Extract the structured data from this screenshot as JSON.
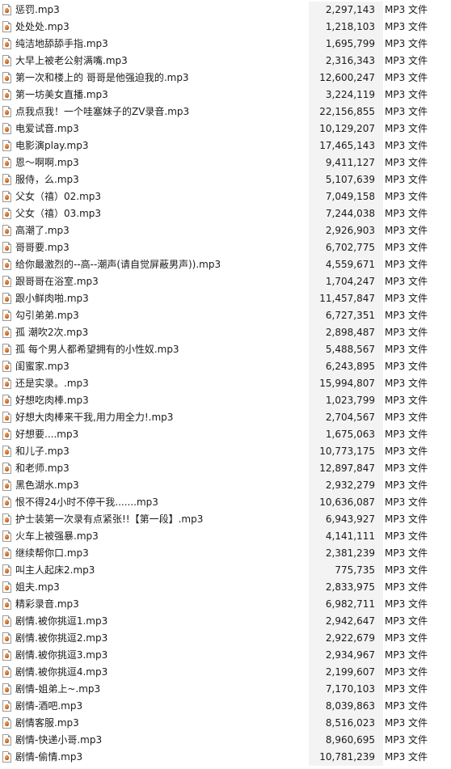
{
  "file_icon_name": "mp3-file-icon",
  "colors": {
    "background": "#ffffff",
    "size_column_band": "#f3f3f3",
    "text": "#1a1a1a"
  },
  "files": [
    {
      "name": "惩罚.mp3",
      "size": "2,297,143",
      "type": "MP3 文件"
    },
    {
      "name": "处处处.mp3",
      "size": "1,218,103",
      "type": "MP3 文件"
    },
    {
      "name": "纯洁地舔舔手指.mp3",
      "size": "1,695,799",
      "type": "MP3 文件"
    },
    {
      "name": "大早上被老公射满嘴.mp3",
      "size": "2,316,343",
      "type": "MP3 文件"
    },
    {
      "name": "第一次和楼上的 哥哥是他强迫我的.mp3",
      "size": "12,600,247",
      "type": "MP3 文件"
    },
    {
      "name": "第一坊美女直播.mp3",
      "size": "3,224,119",
      "type": "MP3 文件"
    },
    {
      "name": "点我点我！一个哇塞妹子的ZV录音.mp3",
      "size": "22,156,855",
      "type": "MP3 文件"
    },
    {
      "name": "电爱试音.mp3",
      "size": "10,129,207",
      "type": "MP3 文件"
    },
    {
      "name": "电影演play.mp3",
      "size": "17,465,143",
      "type": "MP3 文件"
    },
    {
      "name": "恩～啊啊.mp3",
      "size": "9,411,127",
      "type": "MP3 文件"
    },
    {
      "name": "服侍，么.mp3",
      "size": "5,107,639",
      "type": "MP3 文件"
    },
    {
      "name": "父女（禧）02.mp3",
      "size": "7,049,158",
      "type": "MP3 文件"
    },
    {
      "name": "父女（禧）03.mp3",
      "size": "7,244,038",
      "type": "MP3 文件"
    },
    {
      "name": "高潮了.mp3",
      "size": "2,926,903",
      "type": "MP3 文件"
    },
    {
      "name": "哥哥要.mp3",
      "size": "6,702,775",
      "type": "MP3 文件"
    },
    {
      "name": "给你最激烈的--高--潮声(请自觉屏蔽男声)).mp3",
      "size": "4,559,671",
      "type": "MP3 文件"
    },
    {
      "name": "跟哥哥在浴室.mp3",
      "size": "1,704,247",
      "type": "MP3 文件"
    },
    {
      "name": "跟小鲜肉啪.mp3",
      "size": "11,457,847",
      "type": "MP3 文件"
    },
    {
      "name": "勾引弟弟.mp3",
      "size": "6,727,351",
      "type": "MP3 文件"
    },
    {
      "name": "孤 潮吹2次.mp3",
      "size": "2,898,487",
      "type": "MP3 文件"
    },
    {
      "name": "孤 每个男人都希望拥有的小性奴.mp3",
      "size": "5,488,567",
      "type": "MP3 文件"
    },
    {
      "name": "闺蜜家.mp3",
      "size": "6,243,895",
      "type": "MP3 文件"
    },
    {
      "name": "还是实录。.mp3",
      "size": "15,994,807",
      "type": "MP3 文件"
    },
    {
      "name": "好想吃肉棒.mp3",
      "size": "1,023,799",
      "type": "MP3 文件"
    },
    {
      "name": "好想大肉棒来干我,用力用全力!.mp3",
      "size": "2,704,567",
      "type": "MP3 文件"
    },
    {
      "name": "好想要....mp3",
      "size": "1,675,063",
      "type": "MP3 文件"
    },
    {
      "name": "和儿子.mp3",
      "size": "10,773,175",
      "type": "MP3 文件"
    },
    {
      "name": "和老师.mp3",
      "size": "12,897,847",
      "type": "MP3 文件"
    },
    {
      "name": "黑色湖水.mp3",
      "size": "2,932,279",
      "type": "MP3 文件"
    },
    {
      "name": "恨不得24小时不停干我.......mp3",
      "size": "10,636,087",
      "type": "MP3 文件"
    },
    {
      "name": "护士装第一次录有点紧张!!【第一段】.mp3",
      "size": "6,943,927",
      "type": "MP3 文件"
    },
    {
      "name": "火车上被强暴.mp3",
      "size": "4,141,111",
      "type": "MP3 文件"
    },
    {
      "name": "继续帮你口.mp3",
      "size": "2,381,239",
      "type": "MP3 文件"
    },
    {
      "name": "叫主人起床2.mp3",
      "size": "775,735",
      "type": "MP3 文件"
    },
    {
      "name": "姐夫.mp3",
      "size": "2,833,975",
      "type": "MP3 文件"
    },
    {
      "name": "精彩录音.mp3",
      "size": "6,982,711",
      "type": "MP3 文件"
    },
    {
      "name": "剧情.被你挑逗1.mp3",
      "size": "2,942,647",
      "type": "MP3 文件"
    },
    {
      "name": "剧情.被你挑逗2.mp3",
      "size": "2,922,679",
      "type": "MP3 文件"
    },
    {
      "name": "剧情.被你挑逗3.mp3",
      "size": "2,934,967",
      "type": "MP3 文件"
    },
    {
      "name": "剧情.被你挑逗4.mp3",
      "size": "2,199,607",
      "type": "MP3 文件"
    },
    {
      "name": "剧情-姐弟上~.mp3",
      "size": "7,170,103",
      "type": "MP3 文件"
    },
    {
      "name": "剧情-酒吧.mp3",
      "size": "8,039,863",
      "type": "MP3 文件"
    },
    {
      "name": "剧情客服.mp3",
      "size": "8,516,023",
      "type": "MP3 文件"
    },
    {
      "name": "剧情-快递小哥.mp3",
      "size": "8,960,695",
      "type": "MP3 文件"
    },
    {
      "name": "剧情-偷情.mp3",
      "size": "10,781,239",
      "type": "MP3 文件"
    }
  ]
}
